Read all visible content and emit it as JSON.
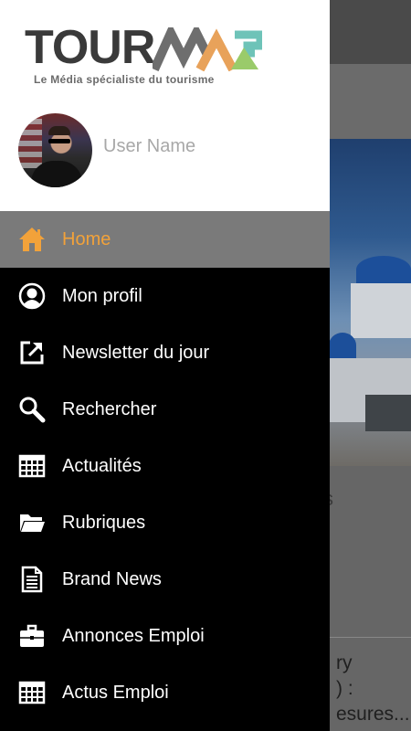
{
  "app": {
    "logo_word": "TOURMAG",
    "logo_text_part": "TOUR",
    "logo_tagline": "Le Média spécialiste du tourisme",
    "accent_color": "#f2a23a"
  },
  "user": {
    "name": "User Name"
  },
  "menu": {
    "items": [
      {
        "label": "Home",
        "icon": "home-icon",
        "active": true
      },
      {
        "label": "Mon profil",
        "icon": "profile-icon"
      },
      {
        "label": "Newsletter du jour",
        "icon": "external-link-icon"
      },
      {
        "label": "Rechercher",
        "icon": "search-icon"
      },
      {
        "label": "Actualités",
        "icon": "news-icon"
      },
      {
        "label": "Rubriques",
        "icon": "folder-icon"
      },
      {
        "label": "Brand News",
        "icon": "document-icon"
      },
      {
        "label": "Annonces Emploi",
        "icon": "briefcase-icon"
      },
      {
        "label": "Actus Emploi",
        "icon": "news-icon"
      }
    ]
  },
  "background": {
    "line1": "ry",
    "line2": ") :",
    "line3": "esures..."
  }
}
